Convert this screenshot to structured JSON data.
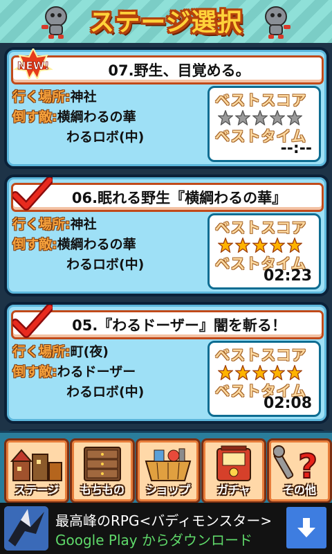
{
  "header": {
    "title": "ステージ選択"
  },
  "stages": [
    {
      "title": "07.野生、目覚める。",
      "badge": "NEW!",
      "location_label": "行く場所:",
      "location": "神社",
      "enemy_label": "倒す敵:",
      "enemies": [
        "横綱わるの華",
        "わるロボ(中)"
      ],
      "best_score_label": "ベストスコア",
      "stars": 0,
      "best_time_label": "ベストタイム",
      "best_time": "--:--"
    },
    {
      "title": "06.眠れる野生『横綱わるの華』",
      "location_label": "行く場所:",
      "location": "神社",
      "enemy_label": "倒す敵:",
      "enemies": [
        "横綱わるの華",
        "わるロボ(中)"
      ],
      "best_score_label": "ベストスコア",
      "stars": 5,
      "best_time_label": "ベストタイム",
      "best_time": "02:23"
    },
    {
      "title": "05.『わるドーザー』闇を斬る！",
      "location_label": "行く場所:",
      "location": "町(夜)",
      "enemy_label": "倒す敵:",
      "enemies": [
        "わるドーザー",
        "わるロボ(中)"
      ],
      "best_score_label": "ベストスコア",
      "stars": 5,
      "best_time_label": "ベストタイム",
      "best_time": "02:08"
    }
  ],
  "menu": [
    {
      "label": "ステージ",
      "icon": "stage-town-icon"
    },
    {
      "label": "もちもの",
      "icon": "inventory-drawer-icon"
    },
    {
      "label": "ショップ",
      "icon": "shop-basket-icon"
    },
    {
      "label": "ガチャ",
      "icon": "gacha-machine-icon"
    },
    {
      "label": "その他",
      "icon": "other-wrench-question-icon"
    }
  ],
  "ad": {
    "title": "最高峰のRPG<バディモンスター>",
    "subtitle": "Google Play からダウンロード",
    "icon": "download-arrow-icon"
  },
  "colors": {
    "accent": "#c14a1a",
    "card": "#9ee0f6",
    "gold_star": "#ffb300",
    "grey_star": "#9a9a9a"
  }
}
